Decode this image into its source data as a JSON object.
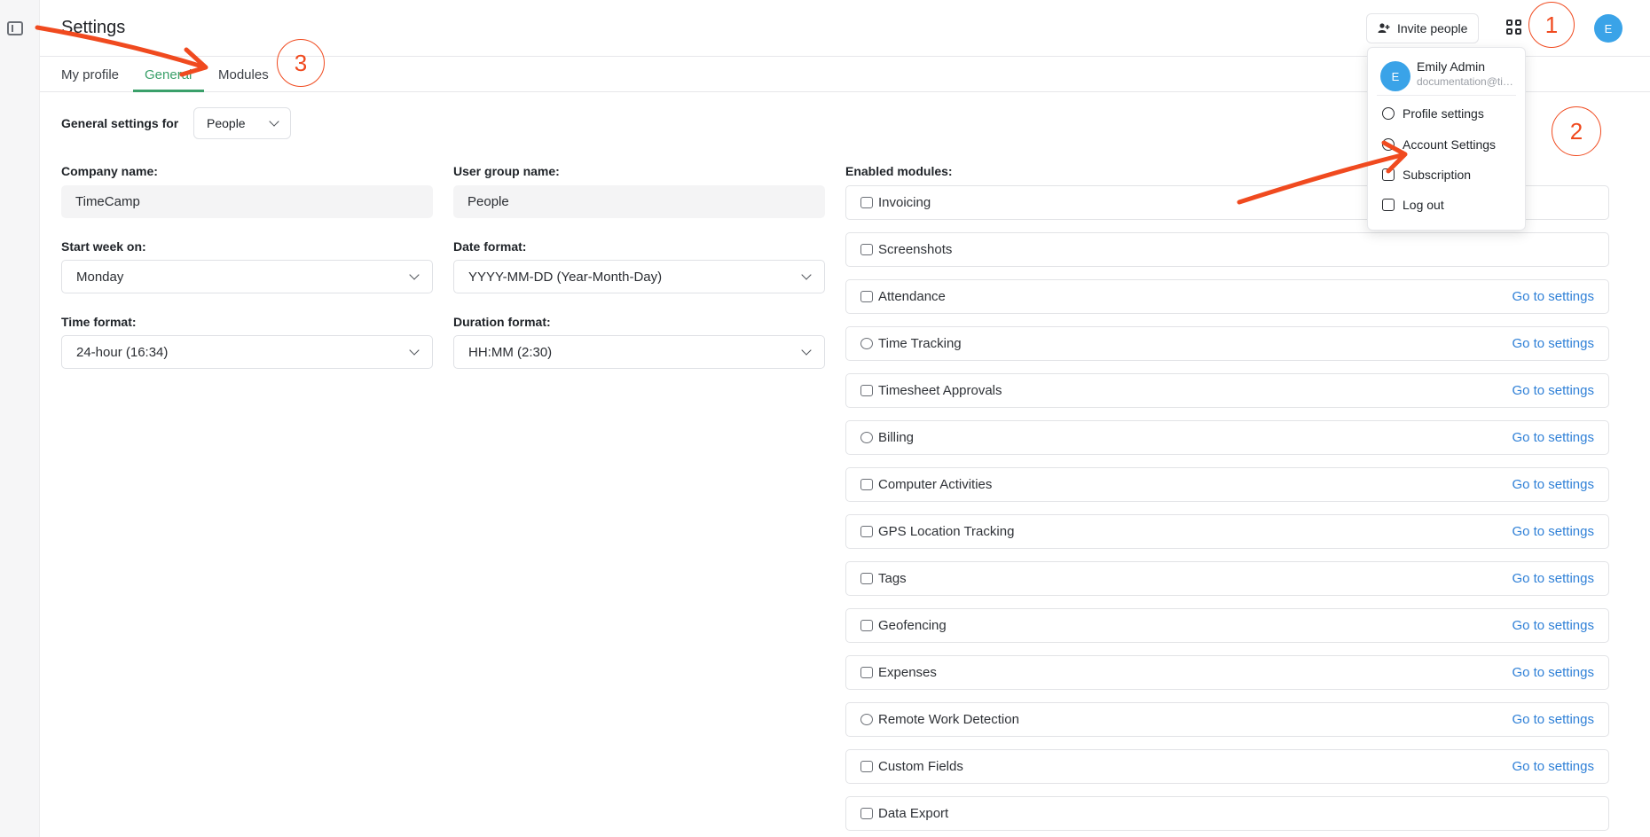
{
  "header": {
    "title": "Settings",
    "invite_label": "Invite people",
    "avatar_initial": "E"
  },
  "tabs": [
    {
      "label": "My profile"
    },
    {
      "label": "General"
    },
    {
      "label": "Modules"
    }
  ],
  "general_for": {
    "label": "General settings for",
    "value": "People"
  },
  "form": {
    "company_name_label": "Company name:",
    "company_name_value": "TimeCamp",
    "user_group_label": "User group name:",
    "user_group_value": "People",
    "start_week_label": "Start week on:",
    "start_week_value": "Monday",
    "date_format_label": "Date format:",
    "date_format_value": "YYYY-MM-DD (Year-Month-Day)",
    "time_format_label": "Time format:",
    "time_format_value": "24-hour (16:34)",
    "duration_format_label": "Duration format:",
    "duration_format_value": "HH:MM (2:30)"
  },
  "modules": {
    "label": "Enabled modules:",
    "link_text": "Go to settings",
    "items": [
      {
        "label": "Invoicing",
        "icon": "invoice-icon"
      },
      {
        "label": "Screenshots",
        "icon": "list-icon"
      },
      {
        "label": "Attendance",
        "icon": "calendar-icon"
      },
      {
        "label": "Time Tracking",
        "icon": "clock-icon"
      },
      {
        "label": "Timesheet Approvals",
        "icon": "inbox-icon"
      },
      {
        "label": "Billing",
        "icon": "dollar-icon"
      },
      {
        "label": "Computer Activities",
        "icon": "network-icon"
      },
      {
        "label": "GPS Location Tracking",
        "icon": "inbox-icon"
      },
      {
        "label": "Tags",
        "icon": "tag-icon"
      },
      {
        "label": "Geofencing",
        "icon": "inbox-icon"
      },
      {
        "label": "Expenses",
        "icon": "tag-icon"
      },
      {
        "label": "Remote Work Detection",
        "icon": "compass-icon"
      },
      {
        "label": "Custom Fields",
        "icon": "tag-icon"
      },
      {
        "label": "Data Export",
        "icon": "export-icon"
      }
    ]
  },
  "dropdown": {
    "user_name": "Emily Admin",
    "user_email": "documentation@timecamp.com",
    "avatar_initial": "E",
    "items": [
      {
        "label": "Profile settings",
        "icon": "user-icon"
      },
      {
        "label": "Account Settings",
        "icon": "gear-icon"
      },
      {
        "label": "Subscription",
        "icon": "credit-card-icon"
      },
      {
        "label": "Log out",
        "icon": "logout-icon"
      }
    ]
  },
  "annotations": [
    "1",
    "2",
    "3"
  ],
  "colors": {
    "accent_green": "#3aa06a",
    "link_blue": "#2f80d7",
    "avatar_blue": "#3aa3e8",
    "annotation_red": "#f04a1f"
  }
}
